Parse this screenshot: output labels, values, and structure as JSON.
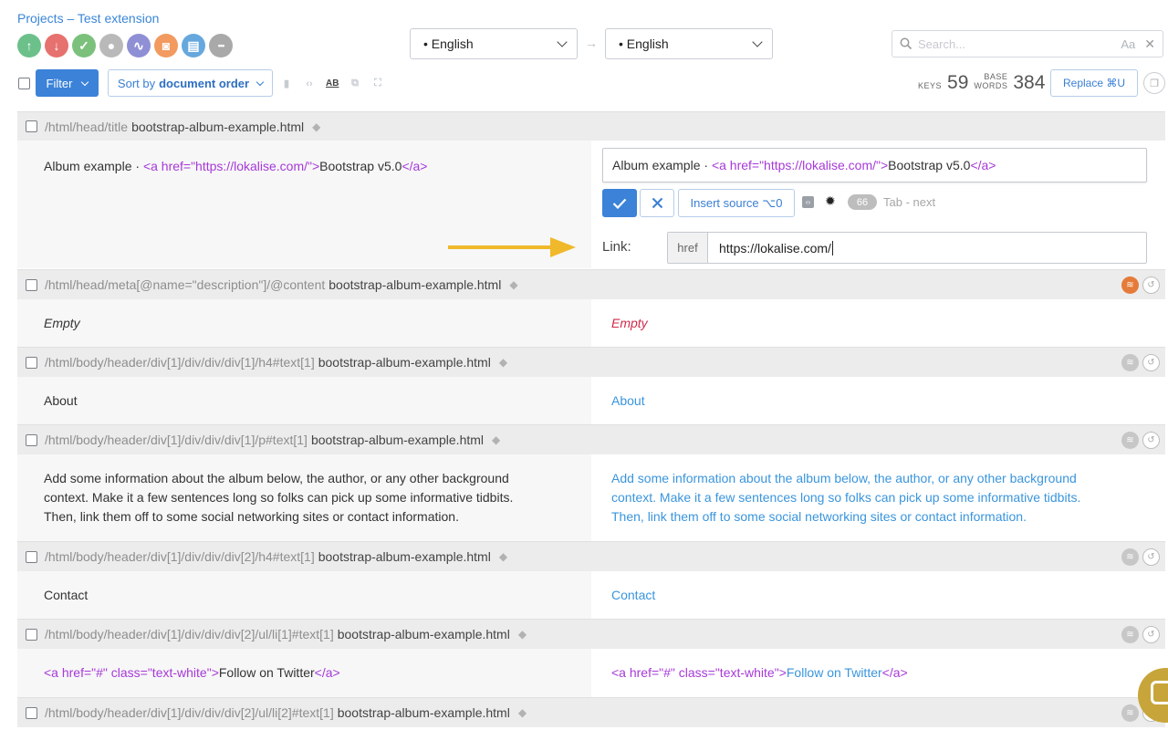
{
  "breadcrumb": {
    "projects": "Projects",
    "sep": " – ",
    "project": "Test extension"
  },
  "tools": [
    {
      "name": "upload-icon",
      "color": "#6cc08a",
      "glyph": "↑"
    },
    {
      "name": "download-icon",
      "color": "#e6716e",
      "glyph": "↓"
    },
    {
      "name": "check-icon",
      "color": "#7bc17c",
      "glyph": "✓"
    },
    {
      "name": "contributor-icon",
      "color": "#b9b9b9",
      "glyph": "●"
    },
    {
      "name": "activity-icon",
      "color": "#8f8fd6",
      "glyph": "∿"
    },
    {
      "name": "screenshot-icon",
      "color": "#f29a5f",
      "glyph": "◙"
    },
    {
      "name": "glossary-icon",
      "color": "#66a8dd",
      "glyph": "▤"
    },
    {
      "name": "more-icon",
      "color": "#a9a9a9",
      "glyph": "•••"
    }
  ],
  "languages": {
    "source": "• English",
    "arrow": "→",
    "target": "• English"
  },
  "search": {
    "placeholder": "Search...",
    "case_toggle": "Aa",
    "clear": "✕"
  },
  "toolbar": {
    "filter": "Filter",
    "sort_prefix": "Sort by",
    "sort_value": "document order",
    "keys_label": "KEYS",
    "keys_count": "59",
    "base_label_1": "BASE",
    "base_label_2": "WORDS",
    "words_count": "384",
    "replace": "Replace ⌘U"
  },
  "editor": {
    "path": "/html/head/title",
    "file": "bootstrap-album-example.html",
    "source_prefix": "Album example · ",
    "source_tag_open": "<a href=\"https://lokalise.com/\">",
    "source_text": "Bootstrap v5.0",
    "source_tag_close": "</a>",
    "target_prefix": "Album example · ",
    "target_tag_open": "<a href=\"https://lokalise.com/\">",
    "target_text": "Bootstrap v5.0",
    "target_tag_close": "</a>",
    "insert_source": "Insert source ⌥0",
    "char_count": "66",
    "tab_hint": "Tab - next",
    "link_label": "Link:",
    "href_prefix": "href",
    "href_value": "https://lokalise.com/"
  },
  "rows": [
    {
      "path": "/html/head/meta[@name=\"description\"]/@content",
      "file": "bootstrap-album-example.html",
      "source": "Empty",
      "target": "Empty"
    },
    {
      "path": "/html/body/header/div[1]/div/div/div[1]/h4#text[1]",
      "file": "bootstrap-album-example.html",
      "source": "About",
      "target": "About"
    },
    {
      "path": "/html/body/header/div[1]/div/div/div[1]/p#text[1]",
      "file": "bootstrap-album-example.html",
      "source_lines": [
        "Add some information about the album below, the author, or any other background",
        "context. Make it a few sentences long so folks can pick up some informative tidbits.",
        "Then, link them off to some social networking sites or contact information."
      ],
      "target_lines": [
        "Add some information about the album below, the author, or any other background",
        "context. Make it a few sentences long so folks can pick up some informative tidbits.",
        "Then, link them off to some social networking sites or contact information."
      ]
    },
    {
      "path": "/html/body/header/div[1]/div/div/div[2]/h4#text[1]",
      "file": "bootstrap-album-example.html",
      "source": "Contact",
      "target": "Contact"
    },
    {
      "path": "/html/body/header/div[1]/div/div/div[2]/ul/li[1]#text[1]",
      "file": "bootstrap-album-example.html",
      "source_tag_open": "<a href=\"#\" class=\"text-white\">",
      "source_text": "Follow on Twitter",
      "source_tag_close": "</a>",
      "target_tag_open": "<a href=\"#\" class=\"text-white\">",
      "target_text": "Follow on Twitter",
      "target_tag_close": "</a>"
    },
    {
      "path": "/html/body/header/div[1]/div/div/div[2]/ul/li[2]#text[1]",
      "file": "bootstrap-album-example.html"
    }
  ],
  "colors": {
    "accent": "#3b82d8",
    "tag": "#a639d8",
    "translation": "#3a95dd",
    "empty_target": "#cf2a4a",
    "annotation_arrow": "#f0b92b"
  }
}
